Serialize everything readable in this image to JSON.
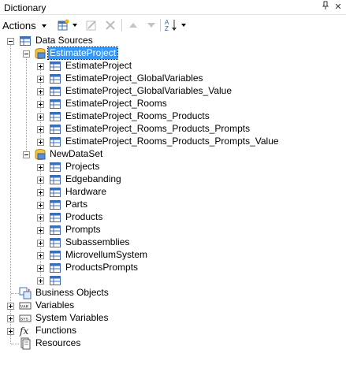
{
  "panel": {
    "title": "Dictionary",
    "pin_glyph": "📌",
    "close_glyph": "✕"
  },
  "toolbar": {
    "actions_label": "Actions"
  },
  "tree": {
    "data_sources": "Data Sources",
    "estimate_project": "EstimateProject",
    "estimate_tables": [
      "EstimateProject",
      "EstimateProject_GlobalVariables",
      "EstimateProject_GlobalVariables_Value",
      "EstimateProject_Rooms",
      "EstimateProject_Rooms_Products",
      "EstimateProject_Rooms_Products_Prompts",
      "EstimateProject_Rooms_Products_Prompts_Value"
    ],
    "new_dataset": "NewDataSet",
    "dataset_tables": [
      "Projects",
      "Edgebanding",
      "Hardware",
      "Parts",
      "Products",
      "Prompts",
      "Subassemblies",
      "MicrovellumSystem",
      "ProductsPrompts",
      ""
    ],
    "business_objects": "Business Objects",
    "variables": "Variables",
    "system_variables": "System Variables",
    "functions": "Functions",
    "resources": "Resources"
  }
}
